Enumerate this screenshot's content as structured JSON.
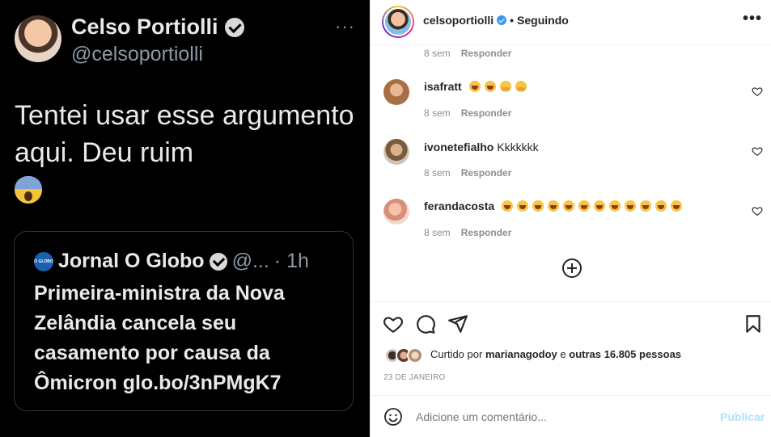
{
  "tweet": {
    "display_name": "Celso Portiolli",
    "handle": "@celsoportiolli",
    "more": "···",
    "text": "Tentei usar esse argumento aqui. Deu ruim",
    "emoji": "fearful-face",
    "quote": {
      "logo_text": "O GLOBO",
      "name": "Jornal O Globo",
      "handle_truncated": "@...",
      "time": "· 1h",
      "text": "Primeira-ministra da Nova Zelândia cancela seu casamento por causa da Ômicron glo.bo/3nPMgK7"
    }
  },
  "instagram": {
    "header": {
      "username": "celsoportiolli",
      "separator": "•",
      "follow_status": "Seguindo",
      "menu": "•••"
    },
    "comments": [
      {
        "username": "",
        "text": "",
        "time": "8 sem",
        "reply": "Responder"
      },
      {
        "username": "isafratt",
        "emojis": [
          "laugh",
          "laugh",
          "hug",
          "hug"
        ],
        "time": "8 sem",
        "reply": "Responder",
        "avatar_color": "#c98b5e"
      },
      {
        "username": "ivonetefialho",
        "text": "Kkkkkkk",
        "time": "8 sem",
        "reply": "Responder",
        "avatar_color": "#b08d6a"
      },
      {
        "username": "ferandacosta",
        "emojis": [
          "laugh",
          "laugh",
          "laugh",
          "laugh",
          "laugh",
          "laugh",
          "laugh",
          "laugh",
          "laugh",
          "laugh",
          "laugh",
          "laugh"
        ],
        "time": "8 sem",
        "reply": "Responder",
        "avatar_color": "#e6a48e"
      }
    ],
    "likes": {
      "prefix": "Curtido por",
      "user": "marianagodoy",
      "middle": "e",
      "others": "outras 16.805 pessoas"
    },
    "date": "23 DE JANEIRO",
    "compose": {
      "placeholder": "Adicione um comentário...",
      "publish": "Publicar"
    },
    "colors": {
      "text": "#262626",
      "muted": "#8e8e8e",
      "publish_disabled": "#b2dffc",
      "verified": "#3897f0"
    }
  }
}
